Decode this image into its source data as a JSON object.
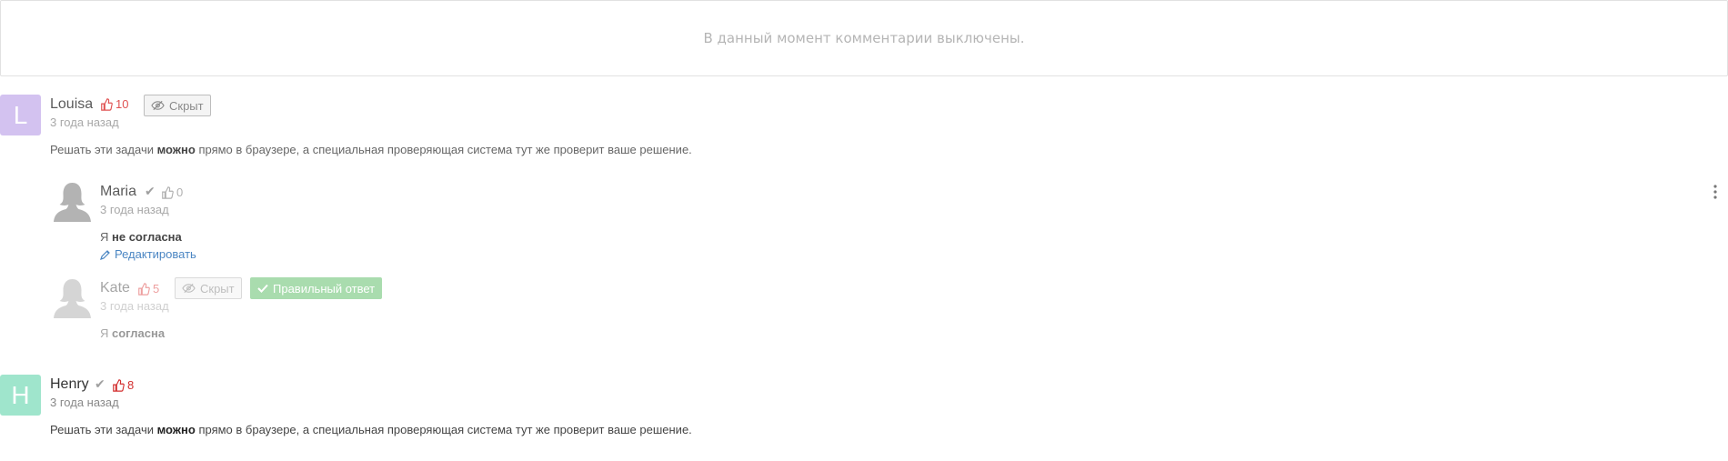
{
  "notice": {
    "text": "В данный момент комментарии выключены."
  },
  "comments": [
    {
      "avatar_letter": "L",
      "avatar_color": "#d3c2f0",
      "author": "Louisa",
      "likes": "10",
      "hide_label": "Скрыт",
      "time": "3 года назад",
      "text_before": "Решать эти задачи ",
      "text_bold": "можно",
      "text_after": " прямо в браузере, а специальная проверяющая система тут же проверит ваше решение."
    },
    {
      "author": "Henry",
      "avatar_letter": "H",
      "avatar_color": "#9fe5cc",
      "likes": "8",
      "time": "3 года назад",
      "text_before": "Решать эти задачи ",
      "text_bold": "можно",
      "text_after": " прямо в браузере, а специальная проверяющая система тут же проверит ваше решение."
    }
  ],
  "replies": [
    {
      "author": "Maria",
      "likes": "0",
      "time": "3 года назад",
      "text_before": "Я ",
      "text_bold": "не согласна",
      "edit_label": "Редактировать"
    },
    {
      "author": "Kate",
      "likes": "5",
      "hide_label": "Скрыт",
      "correct_label": "Правильный ответ",
      "time": "3 года назад",
      "text_before": "Я ",
      "text_bold": "согласна"
    }
  ],
  "icons": {
    "like": "thumb-up-icon",
    "check": "check-icon",
    "hidden": "eye-slash-icon",
    "edit": "pencil-icon",
    "menu": "more-vertical-icon",
    "user": "user-silhouette-icon"
  }
}
